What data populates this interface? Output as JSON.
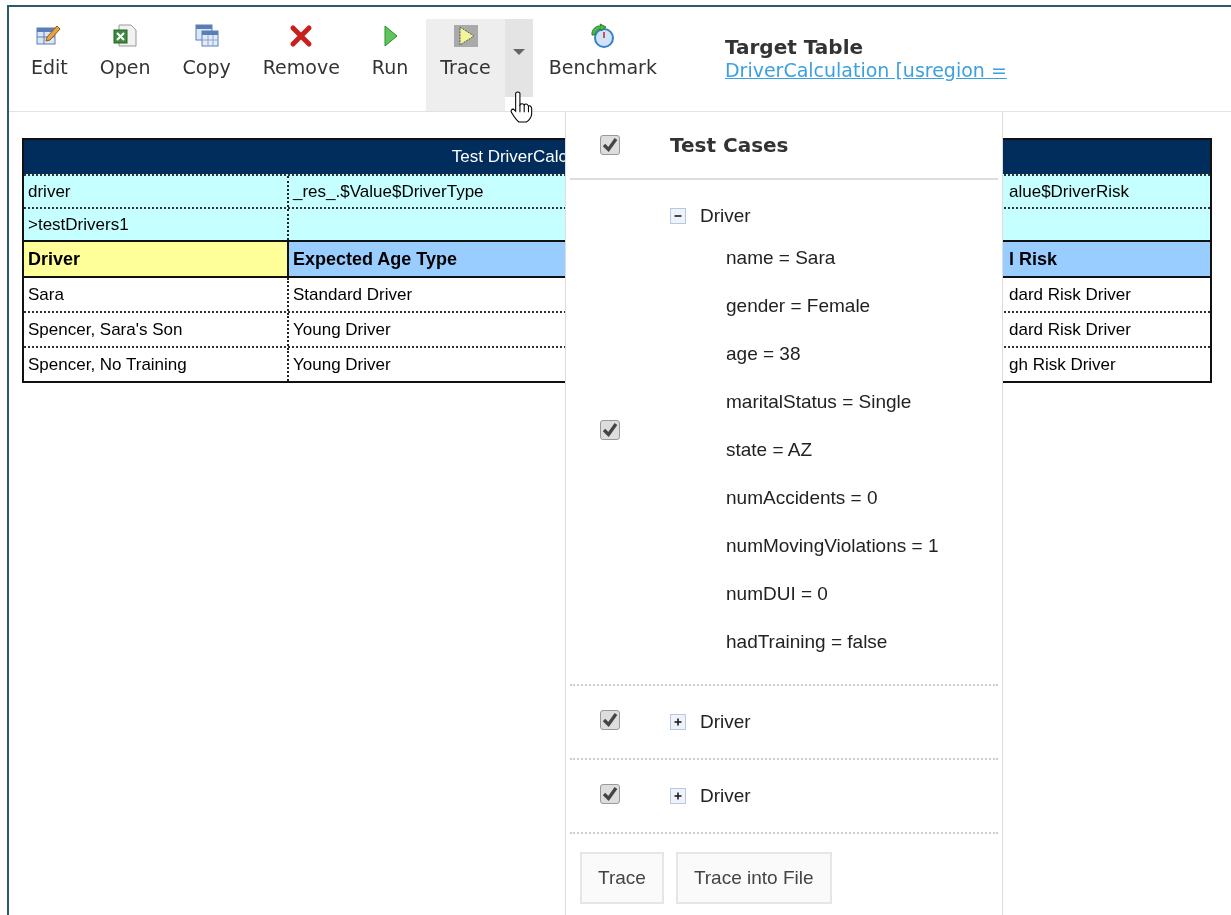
{
  "toolbar": {
    "tools": [
      {
        "kind": "edit",
        "label": "Edit",
        "active": false
      },
      {
        "kind": "open",
        "label": "Open",
        "active": false
      },
      {
        "kind": "copy",
        "label": "Copy",
        "active": false
      },
      {
        "kind": "remove",
        "label": "Remove",
        "active": false
      },
      {
        "kind": "run",
        "label": "Run",
        "active": false
      },
      {
        "kind": "trace",
        "label": "Trace",
        "active": true,
        "dropdown": {
          "expanded": true
        }
      },
      {
        "kind": "benchmark",
        "label": "Benchmark",
        "active": false
      }
    ],
    "target": {
      "title": "Target Table",
      "link": "DriverCalculation [usregion ="
    }
  },
  "table": {
    "title": "Test DriverCalc",
    "rows": [
      {
        "kind": "param",
        "cells": [
          "driver",
          "_res_.$Value$DriverType",
          "alue$DriverRisk"
        ]
      },
      {
        "kind": "param",
        "cells": [
          ">testDrivers1",
          null,
          null
        ]
      },
      {
        "kind": "header",
        "cells": [
          "Driver",
          "Expected Age Type",
          "l Risk"
        ]
      },
      {
        "kind": "data",
        "cells": [
          "Sara",
          "Standard Driver",
          "dard Risk Driver"
        ]
      },
      {
        "kind": "data",
        "cells": [
          "Spencer, Sara's Son",
          " Young Driver",
          "dard Risk Driver"
        ]
      },
      {
        "kind": "data",
        "cells": [
          "Spencer, No Training",
          " Young Driver",
          "gh Risk Driver"
        ]
      }
    ]
  },
  "trace_menu": {
    "header": {
      "label": "Test Cases",
      "checked": true
    },
    "cases": [
      {
        "label": "Driver",
        "checked": true,
        "expanded": true,
        "children": [
          {
            "label": "name = Sara"
          },
          {
            "label": "gender = Female"
          },
          {
            "label": "age = 38"
          },
          {
            "label": "maritalStatus = Single"
          },
          {
            "label": "state = AZ"
          },
          {
            "label": "numAccidents = 0"
          },
          {
            "label": "numMovingViolations = 1"
          },
          {
            "label": "numDUI = 0"
          },
          {
            "label": "hadTraining = false"
          }
        ]
      },
      {
        "label": "Driver",
        "checked": true,
        "expanded": false
      },
      {
        "label": "Driver",
        "checked": true,
        "expanded": false
      }
    ],
    "buttons": [
      "Trace",
      "Trace into File"
    ]
  }
}
